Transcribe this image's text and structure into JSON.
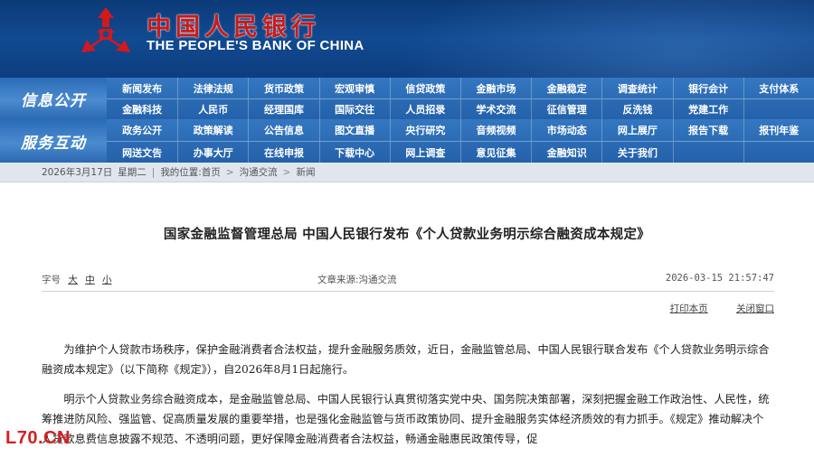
{
  "header": {
    "title_cn": "中国人民银行",
    "title_en": "THE PEOPLE'S BANK OF CHINA",
    "brand_color": "#c81a1a",
    "bg_color": "#114a91"
  },
  "nav": {
    "group1": {
      "label": "信息公开",
      "row1": [
        "新闻发布",
        "法律法规",
        "货币政策",
        "宏观审慎",
        "信贷政策",
        "金融市场",
        "金融稳定",
        "调查统计",
        "银行会计",
        "支付体系"
      ],
      "row2": [
        "金融科技",
        "人民币",
        "经理国库",
        "国际交往",
        "人员招录",
        "学术交流",
        "征信管理",
        "反洗钱",
        "党建工作",
        ""
      ]
    },
    "group2": {
      "label": "服务互动",
      "row1": [
        "政务公开",
        "政策解读",
        "公告信息",
        "图文直播",
        "央行研究",
        "音频视频",
        "市场动态",
        "网上展厅",
        "报告下载",
        "报刊年鉴"
      ],
      "row2": [
        "网送文告",
        "办事大厅",
        "在线申报",
        "下载中心",
        "网上调查",
        "意见征集",
        "金融知识",
        "关于我们",
        "",
        ""
      ]
    }
  },
  "statusbar": {
    "date": "2026年3月17日",
    "weekday": "星期二",
    "location_label": "我的位置:",
    "crumbs": [
      "首页",
      "沟通交流",
      "新闻"
    ]
  },
  "article": {
    "title": "国家金融监督管理总局  中国人民银行发布《个人贷款业务明示综合融资成本规定》",
    "font_size_label": "字号",
    "font_sizes": [
      "大",
      "中",
      "小"
    ],
    "source": "文章来源:沟通交流",
    "timestamp": "2026-03-15  21:57:47",
    "print_label": "打印本页",
    "close_label": "关闭窗口",
    "paragraphs": [
      "为维护个人贷款市场秩序，保护金融消费者合法权益，提升金融服务质效，近日，金融监管总局、中国人民银行联合发布《个人贷款业务明示综合融资成本规定》（以下简称《规定》），自2026年8月1日起施行。",
      "明示个人贷款业务综合融资成本，是金融监管总局、中国人民银行认真贯彻落实党中央、国务院决策部署，深刻把握金融工作政治性、人民性，统筹推进防风险、强监管、促高质量发展的重要举措，也是强化金融监管与货币政策协同、提升金融服务实体经济质效的有力抓手。《规定》推动解决个人贷款息费信息披露不规范、不透明问题，更好保障金融消费者合法权益，畅通金融惠民政策传导，促"
    ]
  },
  "watermark": "L70.CN"
}
